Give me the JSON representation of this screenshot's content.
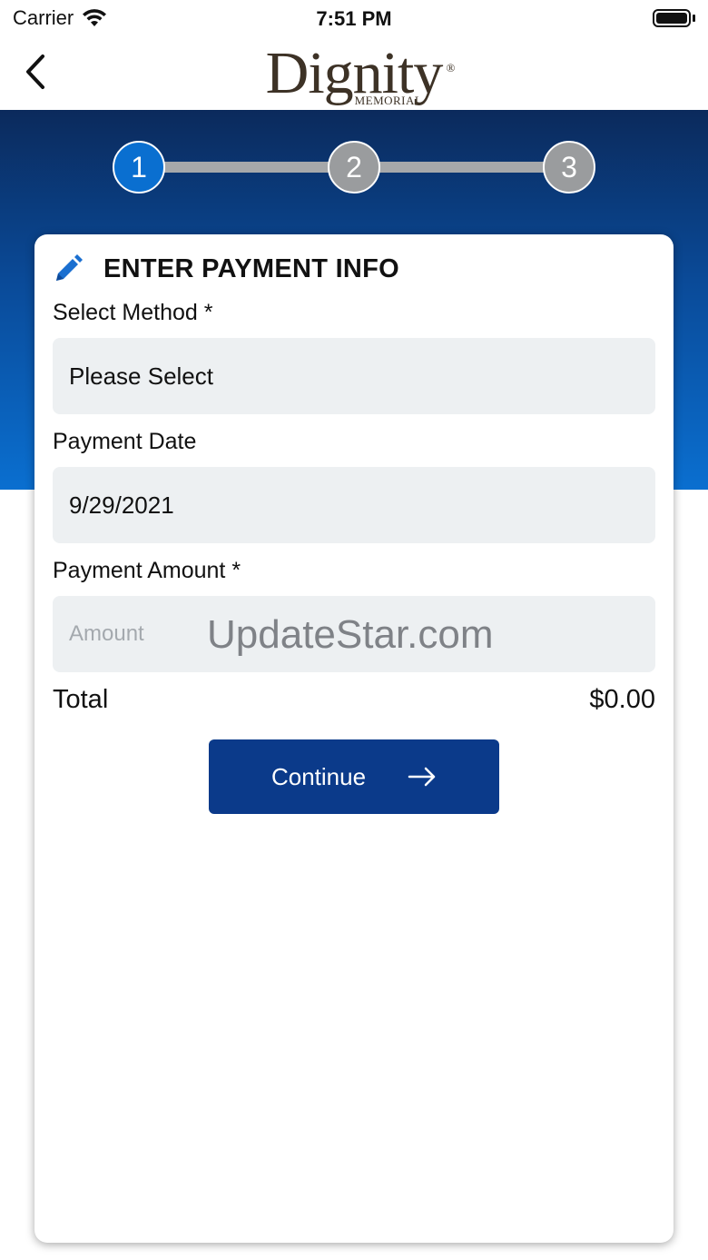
{
  "status_bar": {
    "carrier": "Carrier",
    "time": "7:51 PM"
  },
  "header": {
    "logo_main": "Dignity",
    "logo_sub": "MEMORIAL",
    "logo_reg": "®"
  },
  "stepper": {
    "steps": [
      "1",
      "2",
      "3"
    ],
    "active_step": 1
  },
  "card": {
    "title": "ENTER PAYMENT INFO",
    "method_label": "Select Method *",
    "method_value": "Please Select",
    "date_label": "Payment Date",
    "date_value": "9/29/2021",
    "amount_label": "Payment Amount *",
    "amount_placeholder": "Amount",
    "watermark": "UpdateStar.com",
    "total_label": "Total",
    "total_value": "$0.00",
    "continue_label": "Continue"
  },
  "colors": {
    "brand_blue": "#0b3a8a",
    "active_step": "#0a6fd0",
    "inactive_step": "#9a9c9e",
    "field_bg": "#edf0f2"
  }
}
